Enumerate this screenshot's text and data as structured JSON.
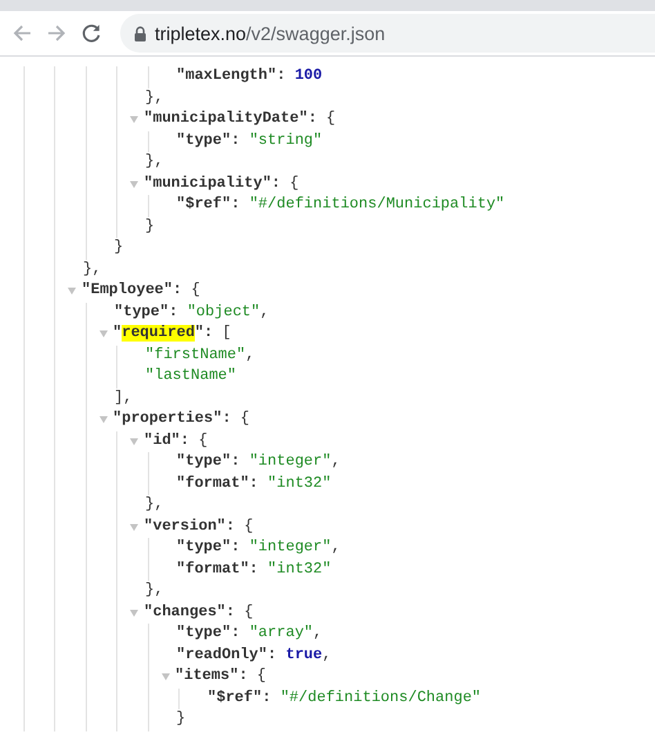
{
  "address_bar": {
    "host": "tripletex.no",
    "path": "/v2/swagger.json"
  },
  "json_tree": [
    {
      "children": [
        {
          "children": [
            {
              "children": [
                {
                  "children": [
                    {
                      "children": [
                        {
                          "key": "\"maxLength\":",
                          "value": "100",
                          "kind": "number"
                        }
                      ],
                      "close": "},"
                    },
                    {
                      "key": "\"municipalityDate\":",
                      "open": "{",
                      "expanded": true,
                      "children": [
                        {
                          "key": "\"type\":",
                          "value": "\"string\"",
                          "kind": "string"
                        }
                      ],
                      "close": "},"
                    },
                    {
                      "key": "\"municipality\":",
                      "open": "{",
                      "expanded": true,
                      "children": [
                        {
                          "key": "\"$ref\":",
                          "value": "\"#/definitions/Municipality\"",
                          "kind": "string"
                        }
                      ],
                      "close": "}"
                    }
                  ],
                  "close": "}"
                }
              ],
              "close": "},"
            },
            {
              "key": "\"Employee\":",
              "open": "{",
              "expanded": true,
              "children": [
                {
                  "key": "\"type\":",
                  "value": "\"object\"",
                  "kind": "string",
                  "tail": ","
                },
                {
                  "key_parts": [
                    {
                      "text": "\"",
                      "highlighted": false
                    },
                    {
                      "text": "required",
                      "highlighted": true
                    },
                    {
                      "text": "\":",
                      "highlighted": false
                    }
                  ],
                  "open": "[",
                  "expanded": true,
                  "children": [
                    {
                      "value": "\"firstName\"",
                      "kind": "string",
                      "tail": ","
                    },
                    {
                      "value": "\"lastName\"",
                      "kind": "string"
                    }
                  ],
                  "close": "],"
                },
                {
                  "key": "\"properties\":",
                  "open": "{",
                  "expanded": true,
                  "children": [
                    {
                      "key": "\"id\":",
                      "open": "{",
                      "expanded": true,
                      "children": [
                        {
                          "key": "\"type\":",
                          "value": "\"integer\"",
                          "kind": "string",
                          "tail": ","
                        },
                        {
                          "key": "\"format\":",
                          "value": "\"int32\"",
                          "kind": "string"
                        }
                      ],
                      "close": "},"
                    },
                    {
                      "key": "\"version\":",
                      "open": "{",
                      "expanded": true,
                      "children": [
                        {
                          "key": "\"type\":",
                          "value": "\"integer\"",
                          "kind": "string",
                          "tail": ","
                        },
                        {
                          "key": "\"format\":",
                          "value": "\"int32\"",
                          "kind": "string"
                        }
                      ],
                      "close": "},"
                    },
                    {
                      "key": "\"changes\":",
                      "open": "{",
                      "expanded": true,
                      "children": [
                        {
                          "key": "\"type\":",
                          "value": "\"array\"",
                          "kind": "string",
                          "tail": ","
                        },
                        {
                          "key": "\"readOnly\":",
                          "value": "true",
                          "kind": "boolean",
                          "tail": ","
                        },
                        {
                          "key": "\"items\":",
                          "open": "{",
                          "expanded": true,
                          "children": [
                            {
                              "key": "\"$ref\":",
                              "value": "\"#/definitions/Change\"",
                              "kind": "string"
                            }
                          ],
                          "close": "}"
                        }
                      ]
                    }
                  ]
                }
              ]
            }
          ]
        }
      ]
    }
  ]
}
